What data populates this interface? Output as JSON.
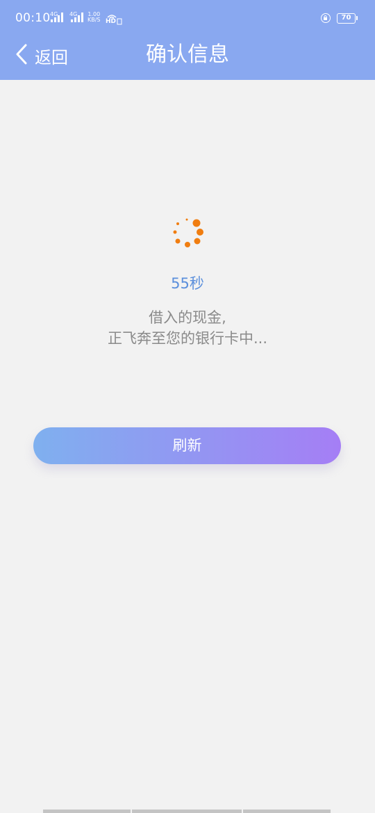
{
  "status_bar": {
    "time": "00:10",
    "signal1_label": "4G",
    "signal2_label": "4G",
    "net_speed_value": "1.00",
    "net_speed_unit": "KB/S",
    "hd_label": "HD",
    "battery_level": "70"
  },
  "header": {
    "back_label": "返回",
    "title": "确认信息"
  },
  "main": {
    "countdown": "55秒",
    "message_line1": "借入的现金,",
    "message_line2": "正飞奔至您的银行卡中...",
    "refresh_label": "刷新"
  },
  "colors": {
    "header_bg": "#89a8f0",
    "page_bg": "#f2f2f2",
    "spinner": "#f07d10",
    "countdown": "#5b8fdc",
    "button_gradient_start": "#7fb0ef",
    "button_gradient_end": "#a57ef5"
  }
}
